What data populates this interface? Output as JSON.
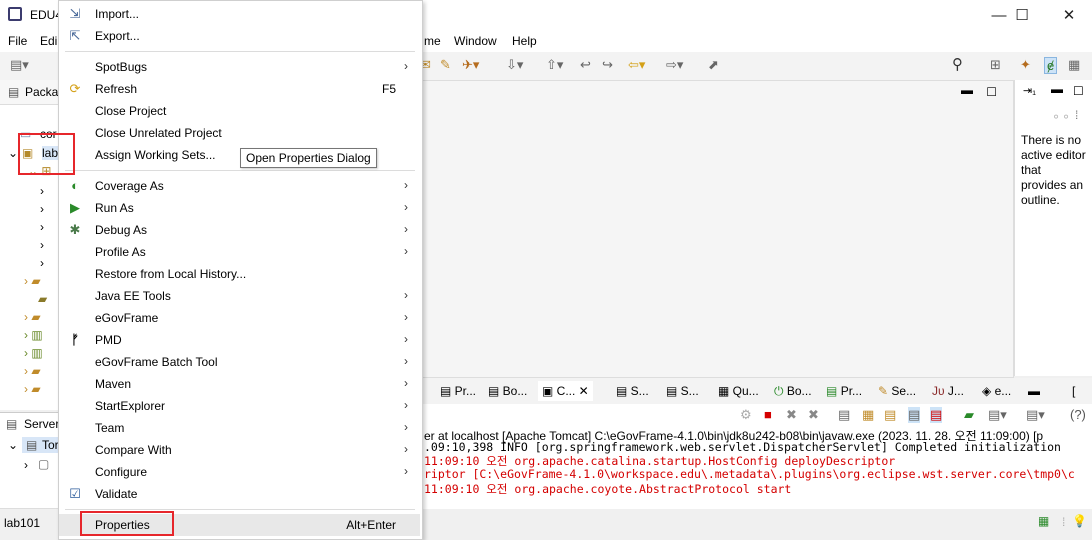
{
  "window": {
    "title": "EDU4",
    "minimize": "—",
    "maximize": "☐",
    "close": "✕"
  },
  "menubar": {
    "file": "File",
    "edit": "Edi",
    "window_partial": "me",
    "window": "Window",
    "help": "Help"
  },
  "package_explorer": {
    "tab_label": "Packa",
    "items": [
      {
        "label": "cor"
      },
      {
        "label": "lab"
      }
    ]
  },
  "servers": {
    "tab_label": "Server",
    "item": "Tor"
  },
  "status_bar": {
    "text": "lab101"
  },
  "outline": {
    "message": "There is no active editor that provides an outline."
  },
  "context_menu": {
    "items": [
      {
        "label": "Import...",
        "icon": "import-icon"
      },
      {
        "label": "Export...",
        "icon": "export-icon"
      },
      {
        "label": "SpotBugs",
        "submenu": true
      },
      {
        "label": "Refresh",
        "shortcut": "F5",
        "icon": "refresh-icon"
      },
      {
        "label": "Close Project"
      },
      {
        "label": "Close Unrelated Project"
      },
      {
        "label": "Assign Working Sets..."
      },
      {
        "label": "Coverage As",
        "submenu": true,
        "icon": "coverage-icon"
      },
      {
        "label": "Run As",
        "submenu": true,
        "icon": "run-icon"
      },
      {
        "label": "Debug As",
        "submenu": true,
        "icon": "debug-icon"
      },
      {
        "label": "Profile As",
        "submenu": true
      },
      {
        "label": "Restore from Local History..."
      },
      {
        "label": "Java EE Tools",
        "submenu": true
      },
      {
        "label": "eGovFrame",
        "submenu": true
      },
      {
        "label": "PMD",
        "submenu": true,
        "icon": "pmd-icon"
      },
      {
        "label": "eGovFrame Batch Tool",
        "submenu": true
      },
      {
        "label": "Maven",
        "submenu": true
      },
      {
        "label": "StartExplorer",
        "submenu": true
      },
      {
        "label": "Team",
        "submenu": true
      },
      {
        "label": "Compare With",
        "submenu": true
      },
      {
        "label": "Configure",
        "submenu": true
      },
      {
        "label": "Validate",
        "icon": "checkbox-icon"
      },
      {
        "label": "Properties",
        "shortcut": "Alt+Enter",
        "highlighted": true
      }
    ]
  },
  "tooltip": {
    "text": "Open Properties Dialog"
  },
  "console": {
    "tabs": [
      "Pr...",
      "Bo...",
      "C...",
      "S...",
      "S...",
      "Qu...",
      "Bo...",
      "Pr...",
      "Se...",
      "J...",
      "e...",
      "["
    ],
    "description": "er at localhost [Apache Tomcat] C:\\eGovFrame-4.1.0\\bin\\jdk8u242-b08\\bin\\javaw.exe  (2023. 11. 28. 오전 11:09:00) [p",
    "lines": [
      {
        "text": ".09:10,398  INFO [org.springframework.web.servlet.DispatcherServlet] Completed initialization",
        "color": "#000000"
      },
      {
        "text": " 11:09:10 오전 org.apache.catalina.startup.HostConfig deployDescriptor",
        "color": "#d40000"
      },
      {
        "text": "riptor [C:\\eGovFrame-4.1.0\\workspace.edu\\.metadata\\.plugins\\org.eclipse.wst.server.core\\tmp0\\c",
        "color": "#d40000"
      },
      {
        "text": " 11:09:10 오전 org.apache.coyote.AbstractProtocol start",
        "color": "#d40000"
      }
    ]
  },
  "colors": {
    "highlight_box": "#e6262b",
    "error_text": "#d40000"
  }
}
